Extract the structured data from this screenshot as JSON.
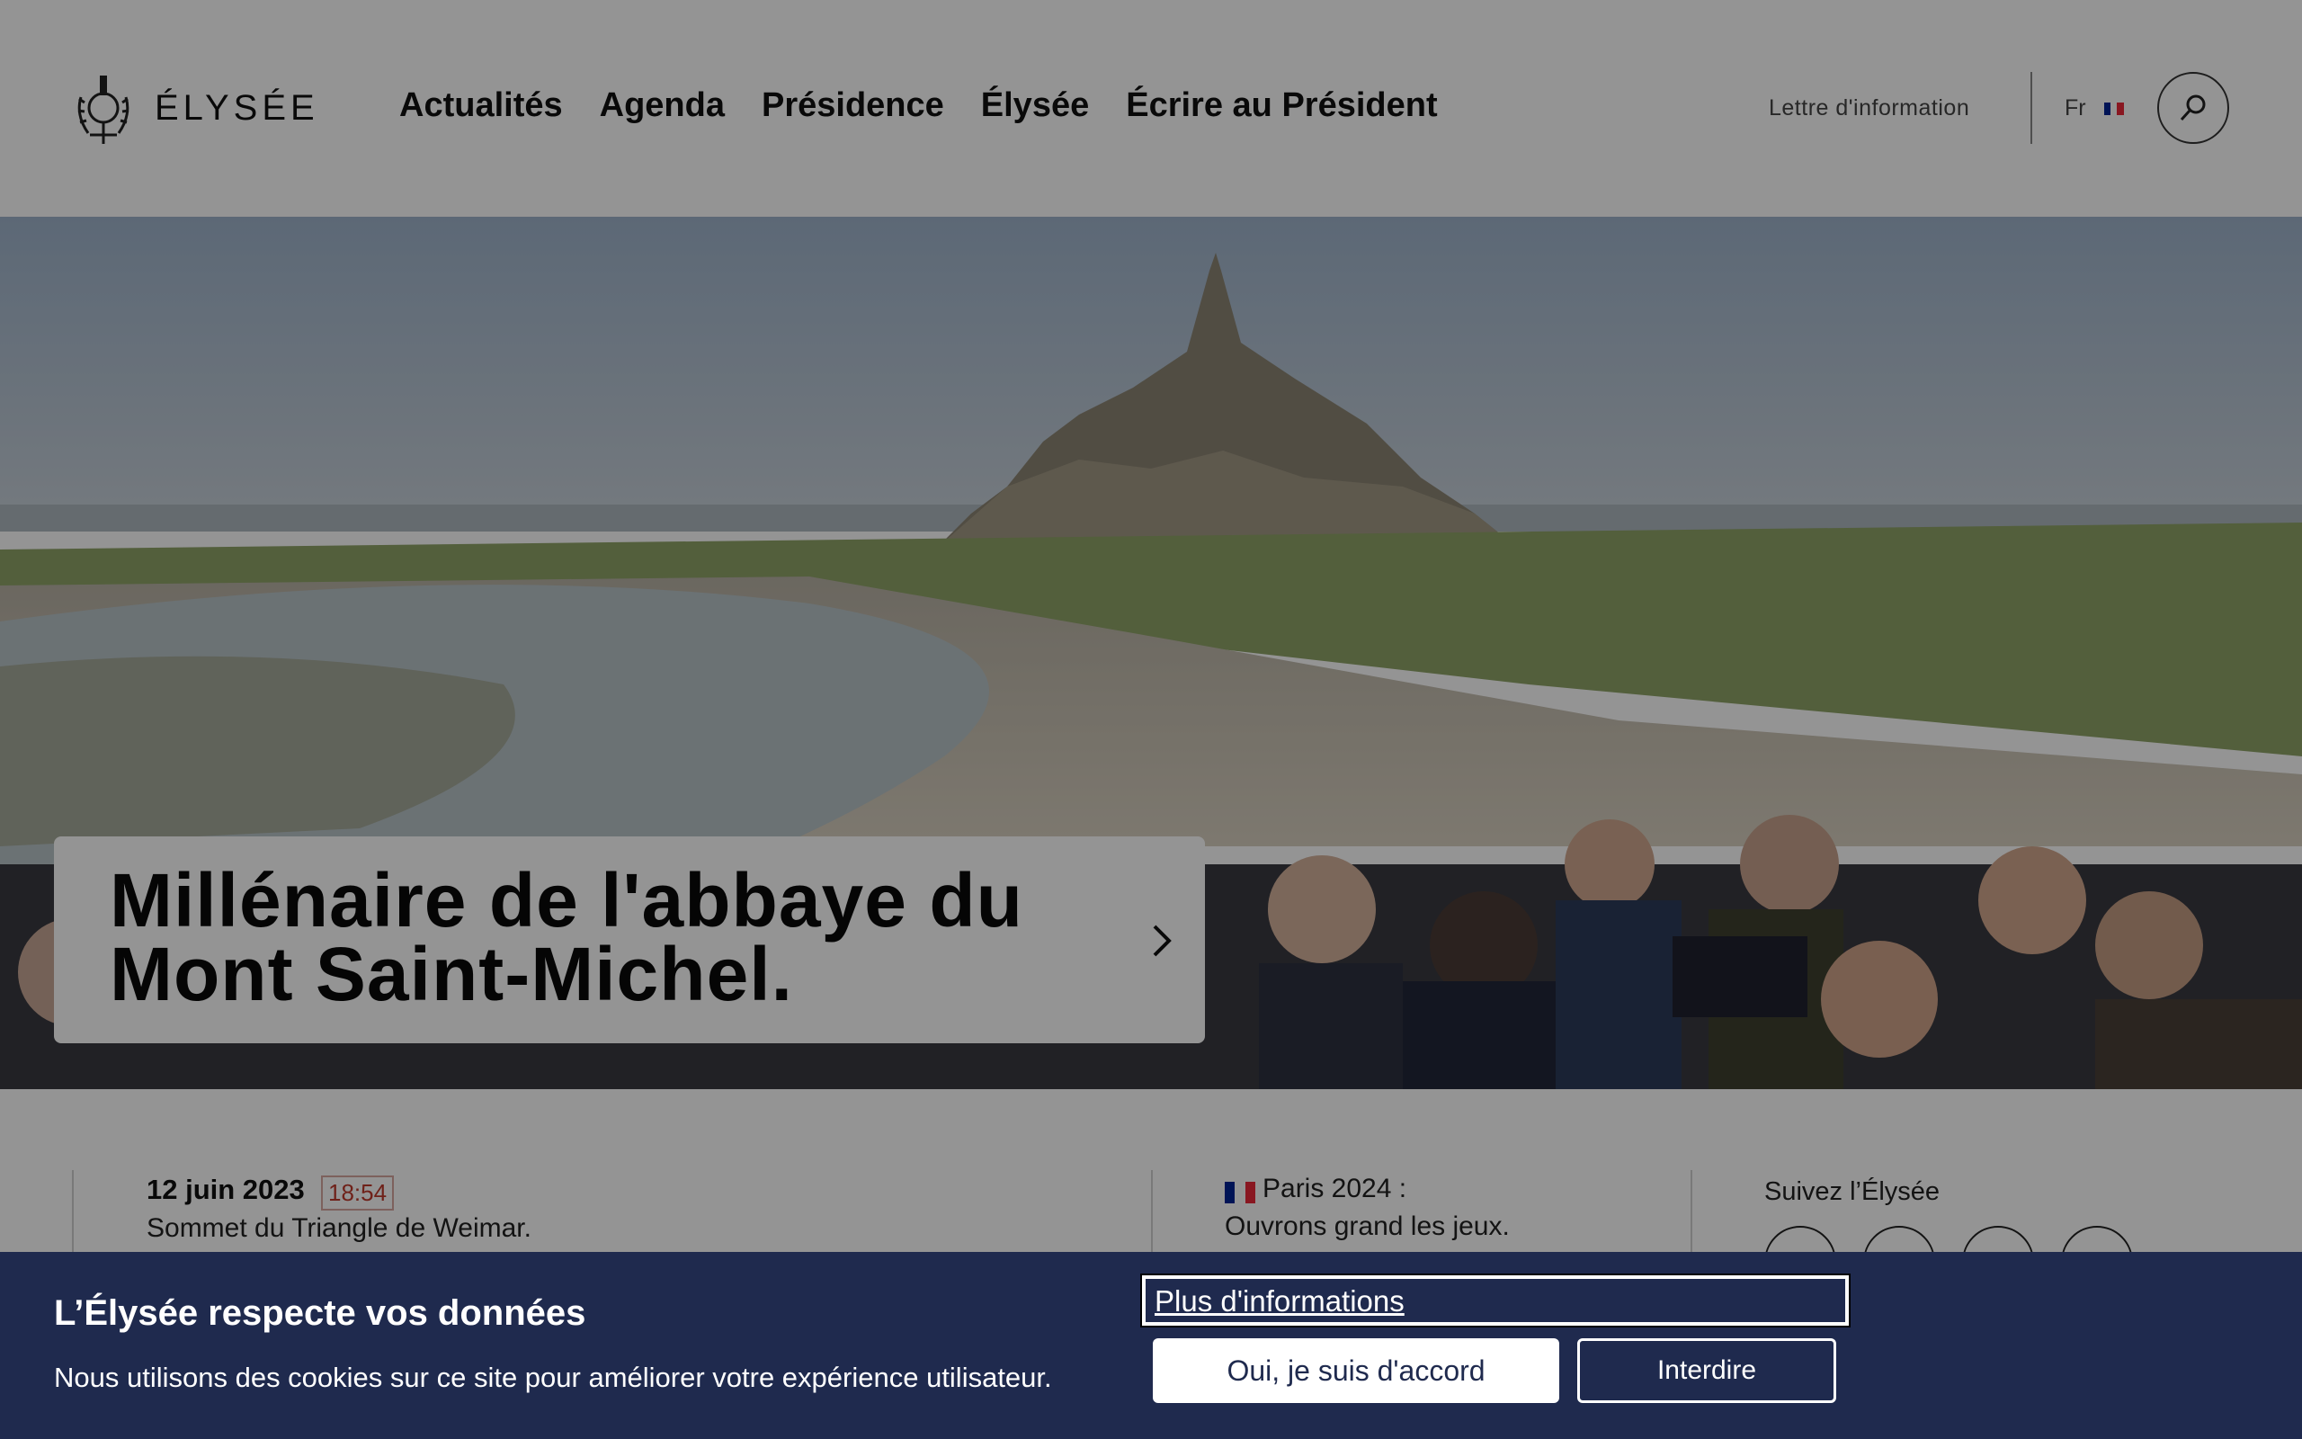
{
  "header": {
    "logo_text": "ÉLYSÉE",
    "nav": [
      "Actualités",
      "Agenda",
      "Présidence",
      "Élysée",
      "Écrire au Président"
    ],
    "newsletter": "Lettre d'information",
    "lang": "Fr"
  },
  "hero": {
    "title": "Millénaire de l'abbaye du Mont Saint-Michel."
  },
  "news": {
    "date": "12 juin 2023",
    "time": "18:54",
    "text": "Sommet du Triangle de Weimar."
  },
  "featured": {
    "line1": "Paris 2024 :",
    "line2": "Ouvrons grand les jeux."
  },
  "follow": {
    "label": "Suivez l’Élysée"
  },
  "cookie": {
    "title": "L’Élysée respecte vos données",
    "text": "Nous utilisons des cookies sur ce site pour améliorer votre expérience utilisateur.",
    "more_link": "Plus d'informations",
    "accept": "Oui, je suis d'accord",
    "deny": "Interdire"
  },
  "colors": {
    "banner": "#1f2a4e",
    "time_badge": "#c0392b",
    "flag_blue": "#002395",
    "flag_red": "#ed2939"
  }
}
